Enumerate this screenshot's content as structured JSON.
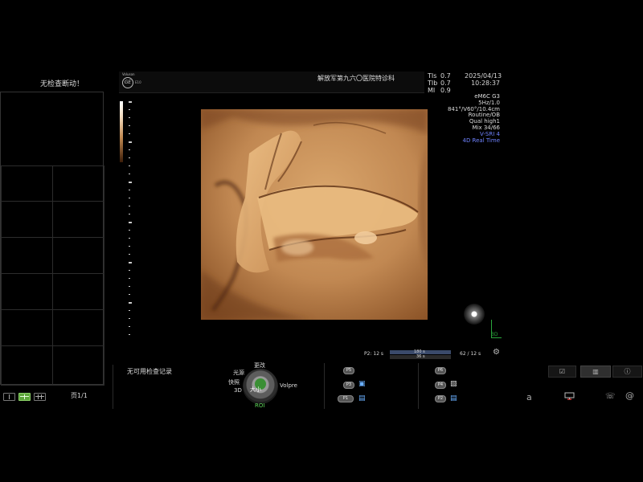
{
  "left_panel": {
    "no_check_text": "无检查断动！",
    "page_label": "页1/1"
  },
  "header": {
    "small_logo_text": "Voluson",
    "logo_text": "GE",
    "model_text": "E10",
    "hospital": "解放军第九六〇医院特诊科",
    "index_labels": [
      "TIs",
      "TIb",
      "MI"
    ],
    "index_values": [
      "0.7",
      "0.7",
      "0.9"
    ],
    "date": "2025/04/13",
    "time": "10:28:37"
  },
  "params": {
    "line1": "eM6C G3",
    "line2": "5Hz/1.0",
    "line3": "841°/V60°/10.4cm",
    "line4": "Routine/OB",
    "line5": "Qual high1",
    "line6": "Mix 34/66",
    "line7": "V-SRI 4",
    "line8": "4D Real Time",
    "accent_color": "#6f83ff"
  },
  "orientation": {
    "label": "3D"
  },
  "cine": {
    "p2_label": "P2:",
    "p2_time": "12 s",
    "bar_value_top": "180 s",
    "bar_value_bottom": "36 s",
    "right_text": "62 / 12 s"
  },
  "controls": {
    "no_record": "无可用检查记录",
    "knob_center": "大小",
    "change": "更改",
    "light": "光源",
    "quick": "快照",
    "three_d": "3D",
    "volpre": "Volpre",
    "roi": "ROI",
    "p_buttons_left": [
      "P5",
      "P3",
      "P1"
    ],
    "p_buttons_right": [
      "P6",
      "P4",
      "P2"
    ]
  },
  "right_panel": {
    "tab_icons": [
      "check-icon",
      "chart-icon",
      "info-icon"
    ],
    "font_label": "a"
  },
  "colors": {
    "active_green": "#5da53b",
    "roi_green": "#5fd95a",
    "sepia": "#c8915a"
  }
}
